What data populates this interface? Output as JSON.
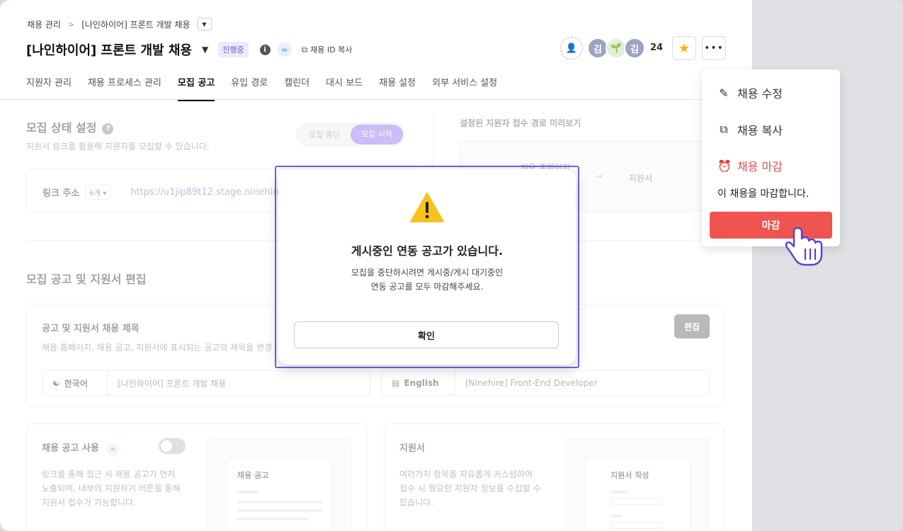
{
  "breadcrumb": {
    "root": "채용 관리",
    "current": "[나인하이어] 프론트 개발 채용"
  },
  "header": {
    "title": "[나인하이어] 프론트 개발 채용",
    "status": "진행중",
    "copy_id": "채용 ID 복사",
    "avatars": [
      "김",
      "🌱",
      "김"
    ],
    "member_count": "24"
  },
  "tabs": [
    "지원자 관리",
    "채용 프로세스 관리",
    "모집 공고",
    "유입 경로",
    "캘린더",
    "대시 보드",
    "채용 설정",
    "외부 서비스 설정"
  ],
  "recruit_status": {
    "title": "모집 상태 설정",
    "desc": "지원서 링크를 활용해 지원자를 모집할 수 있습니다.",
    "off_label": "모집 중단",
    "on_label": "모집 시작",
    "link_label": "링크 주소",
    "link_count": "6개 ▾",
    "link_url": "https://u1jip89t12.stage.ninehire"
  },
  "preview": {
    "title": "설정된 지원자 접수 경로 미리보기",
    "source": "채용 홈페이지",
    "target": "지원서"
  },
  "posting": {
    "section_title": "모집 공고 및 지원서 편집",
    "box_title": "공고 및 지원서 채용 제목",
    "box_desc": "채용 홈페이지, 채용 공고, 지원서에 표시되는 공고의 제목을 변경",
    "edit": "편집",
    "ko_lang": "한국어",
    "ko_value": "[나인하이어] 프론트 개발 채용",
    "en_lang": "English",
    "en_value": "[Ninehire] Front-End Developer"
  },
  "job_post": {
    "title": "채용 공고 사용",
    "desc_1": "링크를 통해 접근 시 채용 공고가 먼저",
    "desc_2": "노출되며, 내부의 지원하기 버튼을 통해",
    "desc_3": "지원서 접수가 가능합니다.",
    "mini_title": "채용 공고"
  },
  "application": {
    "title": "지원서",
    "desc_1": "여러가지 항목을 자유롭게 커스텀하여",
    "desc_2": "접수 시 필요한 지원자 정보를 수집할 수",
    "desc_3": "있습니다.",
    "mini_title": "지원서 작성"
  },
  "modal": {
    "title": "게시중인 연동 공고가 있습니다.",
    "desc_1": "모집을 중단하시려면 게시중/게시 대기중인",
    "desc_2": "연동 공고를 모두 마감해주세요.",
    "confirm": "확인"
  },
  "menu": {
    "edit": "채용 수정",
    "copy": "채용 복사",
    "close": "채용 마감",
    "note": "이 채용을 마감합니다.",
    "close_button": "마감"
  },
  "colors": {
    "accent": "#8b6ff0",
    "danger": "#ef5450",
    "star": "#f5b800"
  }
}
